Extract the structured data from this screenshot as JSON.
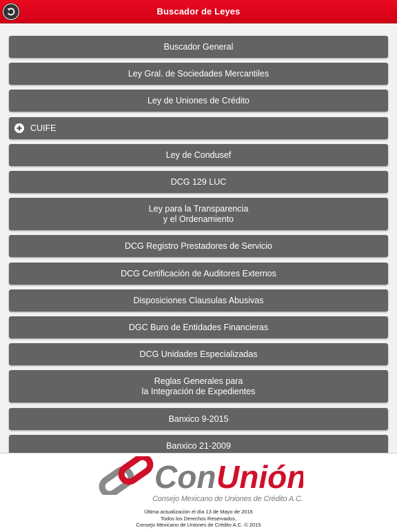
{
  "header": {
    "title": "Buscador de Leyes",
    "back_icon": "back-arrow-icon"
  },
  "menu": {
    "items": [
      {
        "label": "Buscador General"
      },
      {
        "label": "Ley Gral. de Sociedades Mercantiles"
      },
      {
        "label": "Ley de Uniones de Crédito"
      },
      {
        "label": "CUIFE",
        "icon": "plus-icon",
        "expandable": true
      },
      {
        "label": "Ley de Condusef"
      },
      {
        "label": "DCG 129 LUC"
      },
      {
        "label_line1": "Ley para la Transparencia",
        "label_line2": "y el Ordenamiento"
      },
      {
        "label": "DCG Registro Prestadores de Servicio"
      },
      {
        "label": "DCG Certificación de Auditores Externos"
      },
      {
        "label": "Disposiciones Clausulas Abusivas"
      },
      {
        "label": "DGC Buro de Entidades Financieras"
      },
      {
        "label": "DCG Unidades Especializadas"
      },
      {
        "label_line1": "Reglas Generales para",
        "label_line2": "la Integración de Expedientes"
      },
      {
        "label": "Banxico 9-2015"
      },
      {
        "label": "Banxico 21-2009"
      }
    ]
  },
  "footer": {
    "logo_text_1": "Con",
    "logo_text_2": "Unión",
    "logo_subtitle": "Consejo Mexicano de Uniones de Crédito A.C.",
    "line1": "Última actualización el día 13 de Mayo de 2016",
    "line2": "Todos los Derechos Reservados,",
    "line3": "Consejo Mexicano de Uniones de Crédito A.C. © 2015"
  },
  "colors": {
    "header_red": "#e2001a",
    "button_gray": "#636363",
    "logo_gray": "#7d7d7d",
    "logo_red": "#d0102a"
  }
}
